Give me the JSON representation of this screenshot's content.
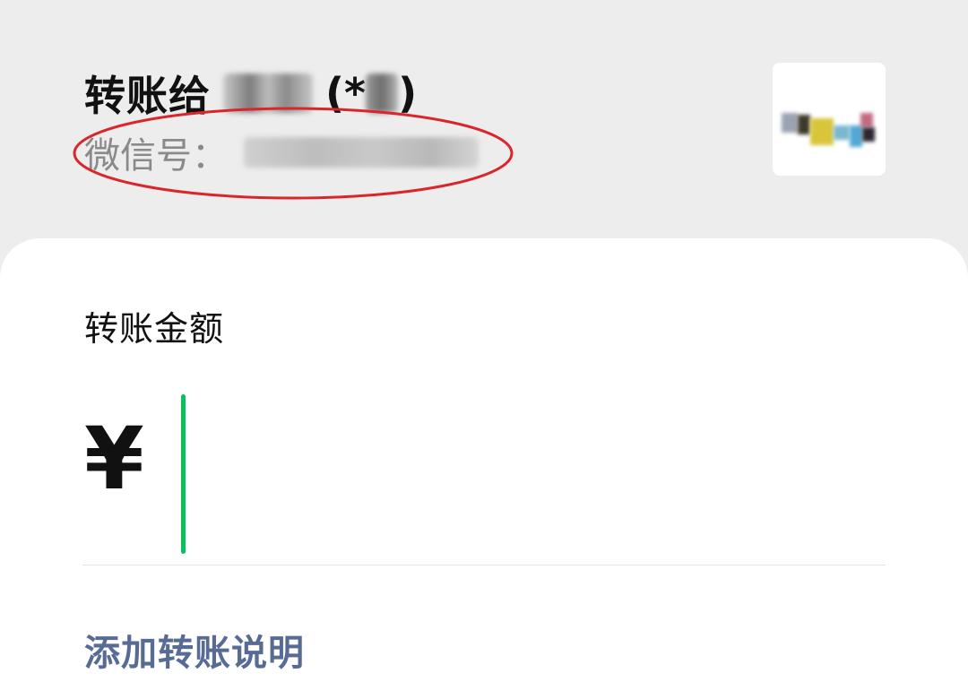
{
  "header": {
    "recipient_prefix": "转账给",
    "paren_open": "(*",
    "paren_close": ")",
    "wechat_id_label": "微信号："
  },
  "amount": {
    "title": "转账金额",
    "currency_symbol": "¥",
    "value": "",
    "cursor_color": "#07c160"
  },
  "actions": {
    "add_note_label": "添加转账说明",
    "link_color": "#576b95"
  },
  "colors": {
    "background": "#ededed",
    "card": "#ffffff",
    "annotation_circle": "#d9262c"
  },
  "icons": {
    "avatar": "avatar-image"
  }
}
